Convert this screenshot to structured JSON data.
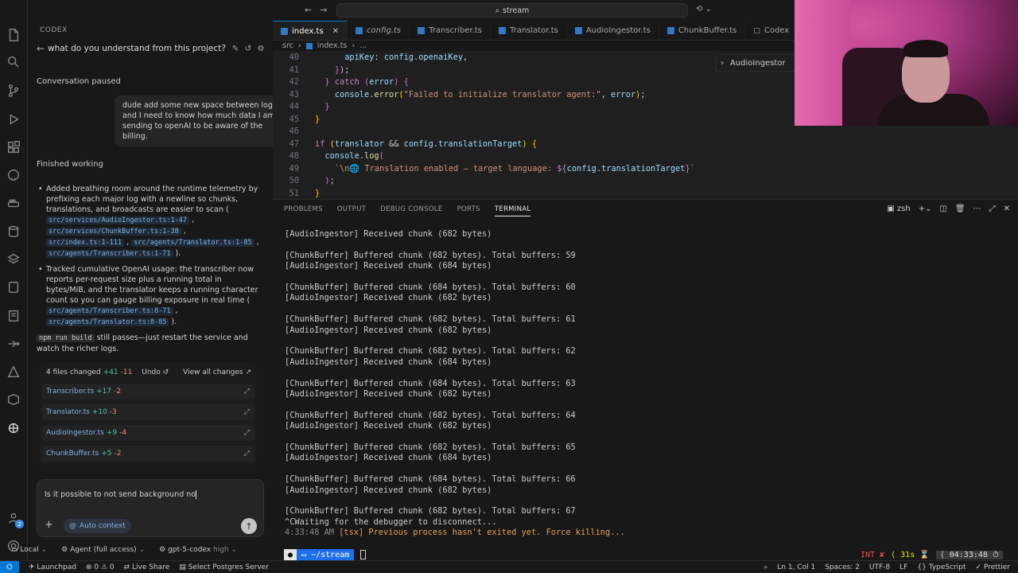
{
  "activity_bar": {
    "icons": [
      "files-icon",
      "search-icon",
      "source-control-icon",
      "run-debug-icon",
      "extensions-icon",
      "github-icon",
      "docker-icon",
      "database-icon",
      "layers-icon",
      "apple-icon",
      "notebook-icon",
      "remote-icon",
      "triangle-icon",
      "box-icon",
      "openai-icon",
      "account-icon",
      "settings-icon"
    ],
    "account_badge": "2"
  },
  "codex": {
    "header": "CODEX",
    "conversation_title": "what do you understand from this project?",
    "paused_label": "Conversation paused",
    "user_message": "dude add some new space between logs and I need to know how much data I am sending to openAI to be aware of the billing.",
    "finished_label": "Finished working",
    "bullet1_text": "Added breathing room around the runtime telemetry by prefixing each major log with a newline so chunks, translations, and broadcasts are easier to scan (",
    "bullet1_refs": [
      "src/services/AudioIngestor.ts:1-47",
      "src/services/ChunkBuffer.ts:1-38",
      "src/index.ts:1-111",
      "src/agents/Translator.ts:1-85",
      "src/agents/Transcriber.ts:1-71"
    ],
    "bullet2_text": "Tracked cumulative OpenAI usage: the transcriber now reports per-request size plus a running total in bytes/MiB, and the translator keeps a running character count so you can gauge billing exposure in real time (",
    "bullet2_refs": [
      "src/agents/Transcriber.ts:8-71",
      "src/agents/Translator.ts:8-85"
    ],
    "build_chip": "npm run build",
    "build_text": "still passes—just restart the service and watch the richer logs.",
    "changes": {
      "summary": "4 files changed",
      "added": "+41",
      "removed": "-11",
      "undo": "Undo",
      "view_all": "View all changes",
      "files": [
        {
          "name": "Transcriber.ts",
          "added": "+17",
          "removed": "-2"
        },
        {
          "name": "Translator.ts",
          "added": "+10",
          "removed": "-3"
        },
        {
          "name": "AudioIngestor.ts",
          "added": "+9",
          "removed": "-4"
        },
        {
          "name": "ChunkBuffer.ts",
          "added": "+5",
          "removed": "-2"
        }
      ]
    },
    "input_text": "Is it possible to not send background no",
    "auto_context": "Auto context",
    "footer": {
      "mode": "Local",
      "agent": "Agent (full access)",
      "model": "gpt-5-codex",
      "effort": "high"
    }
  },
  "topbar": {
    "search": "stream"
  },
  "tabs": [
    {
      "label": "index.ts",
      "active": true,
      "italic": false
    },
    {
      "label": "config.ts",
      "active": false,
      "italic": true
    },
    {
      "label": "Transcriber.ts",
      "active": false,
      "italic": false
    },
    {
      "label": "Translator.ts",
      "active": false,
      "italic": false
    },
    {
      "label": "AudioIngestor.ts",
      "active": false,
      "italic": false
    },
    {
      "label": "ChunkBuffer.ts",
      "active": false,
      "italic": false
    },
    {
      "label": "Codex",
      "active": false,
      "italic": false
    }
  ],
  "breadcrumb": {
    "folder": "src",
    "file": "index.ts",
    "more": "..."
  },
  "outline_item": "AudioIngestor",
  "editor_lines": [
    {
      "n": "40",
      "code": "      apiKey: config.openaiKey,"
    },
    {
      "n": "41",
      "code": "    });"
    },
    {
      "n": "42",
      "code": "  } catch (error) {"
    },
    {
      "n": "43",
      "code": "    console.error(\"Failed to initialize translator agent:\", error);"
    },
    {
      "n": "44",
      "code": "  }"
    },
    {
      "n": "45",
      "code": "}"
    },
    {
      "n": "46",
      "code": ""
    },
    {
      "n": "47",
      "code": "if (translator && config.translationTarget) {"
    },
    {
      "n": "48",
      "code": "  console.log("
    },
    {
      "n": "49",
      "code": "    `\\n🌐 Translation enabled – target language: ${config.translationTarget}`"
    },
    {
      "n": "50",
      "code": "  );"
    },
    {
      "n": "51",
      "code": "}"
    }
  ],
  "panel": {
    "tabs": [
      "PROBLEMS",
      "OUTPUT",
      "DEBUG CONSOLE",
      "PORTS",
      "TERMINAL"
    ],
    "shell": "zsh"
  },
  "terminal_lines": [
    "[AudioIngestor] Received chunk (682 bytes)",
    "",
    "[ChunkBuffer] Buffered chunk (682 bytes). Total buffers: 59",
    "[AudioIngestor] Received chunk (684 bytes)",
    "",
    "[ChunkBuffer] Buffered chunk (684 bytes). Total buffers: 60",
    "[AudioIngestor] Received chunk (682 bytes)",
    "",
    "[ChunkBuffer] Buffered chunk (682 bytes). Total buffers: 61",
    "[AudioIngestor] Received chunk (682 bytes)",
    "",
    "[ChunkBuffer] Buffered chunk (682 bytes). Total buffers: 62",
    "[AudioIngestor] Received chunk (684 bytes)",
    "",
    "[ChunkBuffer] Buffered chunk (684 bytes). Total buffers: 63",
    "[AudioIngestor] Received chunk (682 bytes)",
    "",
    "[ChunkBuffer] Buffered chunk (682 bytes). Total buffers: 64",
    "[AudioIngestor] Received chunk (682 bytes)",
    "",
    "[ChunkBuffer] Buffered chunk (682 bytes). Total buffers: 65",
    "[AudioIngestor] Received chunk (684 bytes)",
    "",
    "[ChunkBuffer] Buffered chunk (684 bytes). Total buffers: 66",
    "[AudioIngestor] Received chunk (682 bytes)",
    "",
    "[ChunkBuffer] Buffered chunk (682 bytes). Total buffers: 67",
    "^CWaiting for the debugger to disconnect..."
  ],
  "terminal_kill": {
    "time": "4:33:48 AM",
    "tag": "[tsx]",
    "msg": "Previous process hasn't exited yet. Force killing..."
  },
  "prompt": {
    "path": "~/stream",
    "status": "INT ✘",
    "duration": "31s",
    "clock": "04:33:48"
  },
  "statusbar": {
    "launchpad": "Launchpad",
    "problems": "⊗ 0  ⚠ 0",
    "live_share": "Live Share",
    "postgres": "Select Postgres Server",
    "position": "Ln 1, Col 1",
    "spaces": "Spaces: 2",
    "encoding": "UTF-8",
    "eol": "LF",
    "language": "TypeScript",
    "formatter": "✓ Prettier"
  },
  "colors": {
    "accent": "#0078d4",
    "added": "#4ec9b0",
    "removed": "#f48771",
    "link": "#7fb2e5"
  }
}
